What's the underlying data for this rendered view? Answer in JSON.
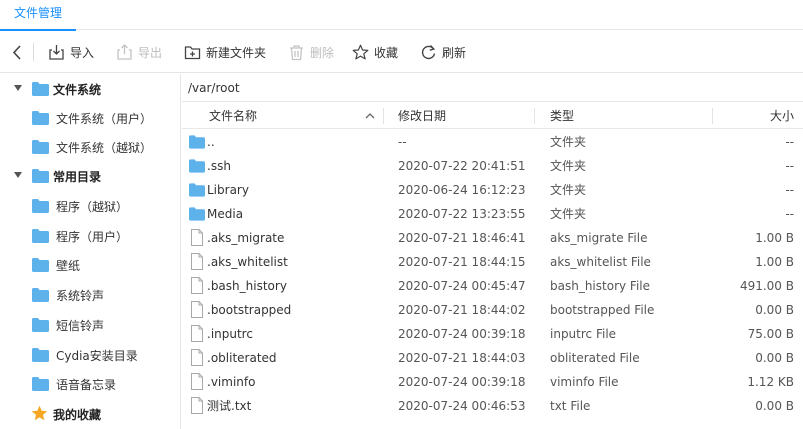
{
  "tabs": [
    {
      "label": "文件管理",
      "active": true
    }
  ],
  "toolbar": {
    "back_label": "",
    "import_label": "导入",
    "export_label": "导出",
    "new_folder_label": "新建文件夹",
    "delete_label": "删除",
    "favorite_label": "收藏",
    "refresh_label": "刷新"
  },
  "sidebar": {
    "items": [
      {
        "label": "文件系统",
        "kind": "group",
        "icon": "folder-icon"
      },
      {
        "label": "文件系统（用户）",
        "kind": "child",
        "icon": "folder-icon"
      },
      {
        "label": "文件系统（越狱）",
        "kind": "child",
        "icon": "folder-icon"
      },
      {
        "label": "常用目录",
        "kind": "group",
        "icon": "folder-icon"
      },
      {
        "label": "程序（越狱）",
        "kind": "child",
        "icon": "folder-icon"
      },
      {
        "label": "程序（用户）",
        "kind": "child",
        "icon": "folder-icon"
      },
      {
        "label": "壁纸",
        "kind": "child",
        "icon": "folder-icon"
      },
      {
        "label": "系统铃声",
        "kind": "child",
        "icon": "folder-icon"
      },
      {
        "label": "短信铃声",
        "kind": "child",
        "icon": "folder-icon"
      },
      {
        "label": "Cydia安装目录",
        "kind": "child",
        "icon": "folder-icon"
      },
      {
        "label": "语音备忘录",
        "kind": "child",
        "icon": "folder-icon"
      },
      {
        "label": "我的收藏",
        "kind": "favorite",
        "icon": "star-icon"
      }
    ]
  },
  "path": "/var/root",
  "table": {
    "columns": {
      "name": "文件名称",
      "date": "修改日期",
      "type": "类型",
      "size": "大小"
    },
    "rows": [
      {
        "name": "..",
        "date": "--",
        "type": "文件夹",
        "size": "--",
        "kind": "folder"
      },
      {
        "name": ".ssh",
        "date": "2020-07-22 20:41:51",
        "type": "文件夹",
        "size": "--",
        "kind": "folder"
      },
      {
        "name": "Library",
        "date": "2020-06-24 16:12:23",
        "type": "文件夹",
        "size": "--",
        "kind": "folder"
      },
      {
        "name": "Media",
        "date": "2020-07-22 13:23:55",
        "type": "文件夹",
        "size": "--",
        "kind": "folder"
      },
      {
        "name": ".aks_migrate",
        "date": "2020-07-21 18:46:41",
        "type": "aks_migrate File",
        "size": "1.00 B",
        "kind": "file"
      },
      {
        "name": ".aks_whitelist",
        "date": "2020-07-21 18:44:15",
        "type": "aks_whitelist File",
        "size": "1.00 B",
        "kind": "file"
      },
      {
        "name": ".bash_history",
        "date": "2020-07-24 00:45:47",
        "type": "bash_history File",
        "size": "491.00 B",
        "kind": "file"
      },
      {
        "name": ".bootstrapped",
        "date": "2020-07-21 18:44:02",
        "type": "bootstrapped File",
        "size": "0.00 B",
        "kind": "file"
      },
      {
        "name": ".inputrc",
        "date": "2020-07-24 00:39:18",
        "type": "inputrc File",
        "size": "75.00 B",
        "kind": "file"
      },
      {
        "name": ".obliterated",
        "date": "2020-07-21 18:44:03",
        "type": "obliterated File",
        "size": "0.00 B",
        "kind": "file"
      },
      {
        "name": ".viminfo",
        "date": "2020-07-24 00:39:18",
        "type": "viminfo File",
        "size": "1.12 KB",
        "kind": "file"
      },
      {
        "name": "测试.txt",
        "date": "2020-07-24 00:46:53",
        "type": "txt File",
        "size": "0.00 B",
        "kind": "file"
      }
    ]
  },
  "colors": {
    "accent": "#1890ff",
    "folder": "#5db2ec",
    "star": "#f5a623"
  }
}
